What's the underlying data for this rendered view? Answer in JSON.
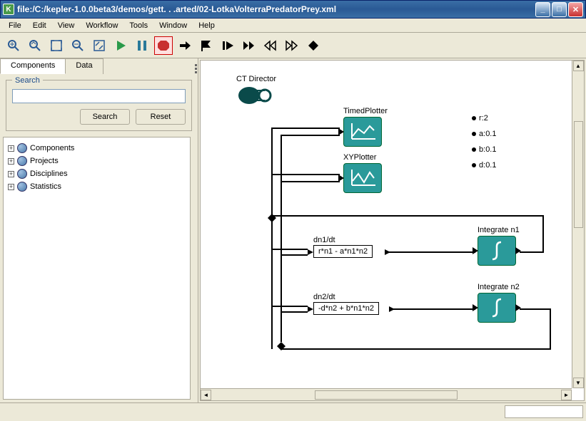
{
  "window": {
    "title": "file:/C:/kepler-1.0.0beta3/demos/gett. . .arted/02-LotkaVolterraPredatorPrey.xml",
    "app_icon": "K"
  },
  "menu": [
    "File",
    "Edit",
    "View",
    "Workflow",
    "Tools",
    "Window",
    "Help"
  ],
  "sidebar": {
    "tabs": [
      "Components",
      "Data"
    ],
    "search": {
      "legend": "Search",
      "placeholder": "",
      "search_btn": "Search",
      "reset_btn": "Reset"
    },
    "tree": [
      "Components",
      "Projects",
      "Disciplines",
      "Statistics"
    ]
  },
  "canvas": {
    "director": "CT Director",
    "params": [
      {
        "name": "r",
        "value": "2"
      },
      {
        "name": "a",
        "value": "0.1"
      },
      {
        "name": "b",
        "value": "0.1"
      },
      {
        "name": "d",
        "value": "0.1"
      }
    ],
    "actors": {
      "timed": "TimedPlotter",
      "xy": "XYPlotter",
      "dn1_label": "dn1/dt",
      "dn1_expr": "r*n1 - a*n1*n2",
      "dn2_label": "dn2/dt",
      "dn2_expr": "-d*n2 + b*n1*n2",
      "int1": "Integrate n1",
      "int2": "Integrate n2"
    }
  }
}
